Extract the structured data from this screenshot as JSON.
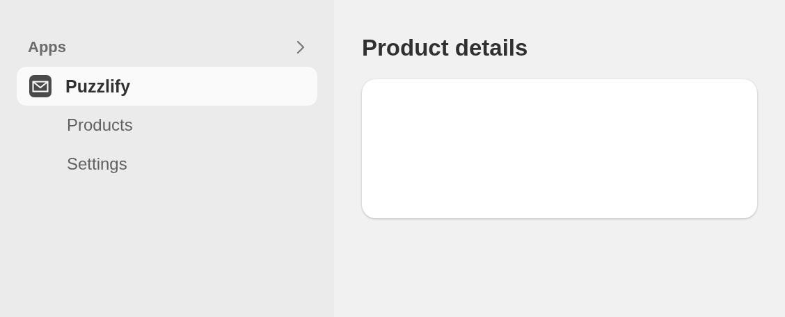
{
  "sidebar": {
    "section_label": "Apps",
    "apps": [
      {
        "label": "Puzzlify",
        "selected": true,
        "children": [
          {
            "label": "Products",
            "selected": false
          },
          {
            "label": "Settings",
            "selected": false
          }
        ]
      }
    ]
  },
  "main": {
    "title": "Product details"
  }
}
